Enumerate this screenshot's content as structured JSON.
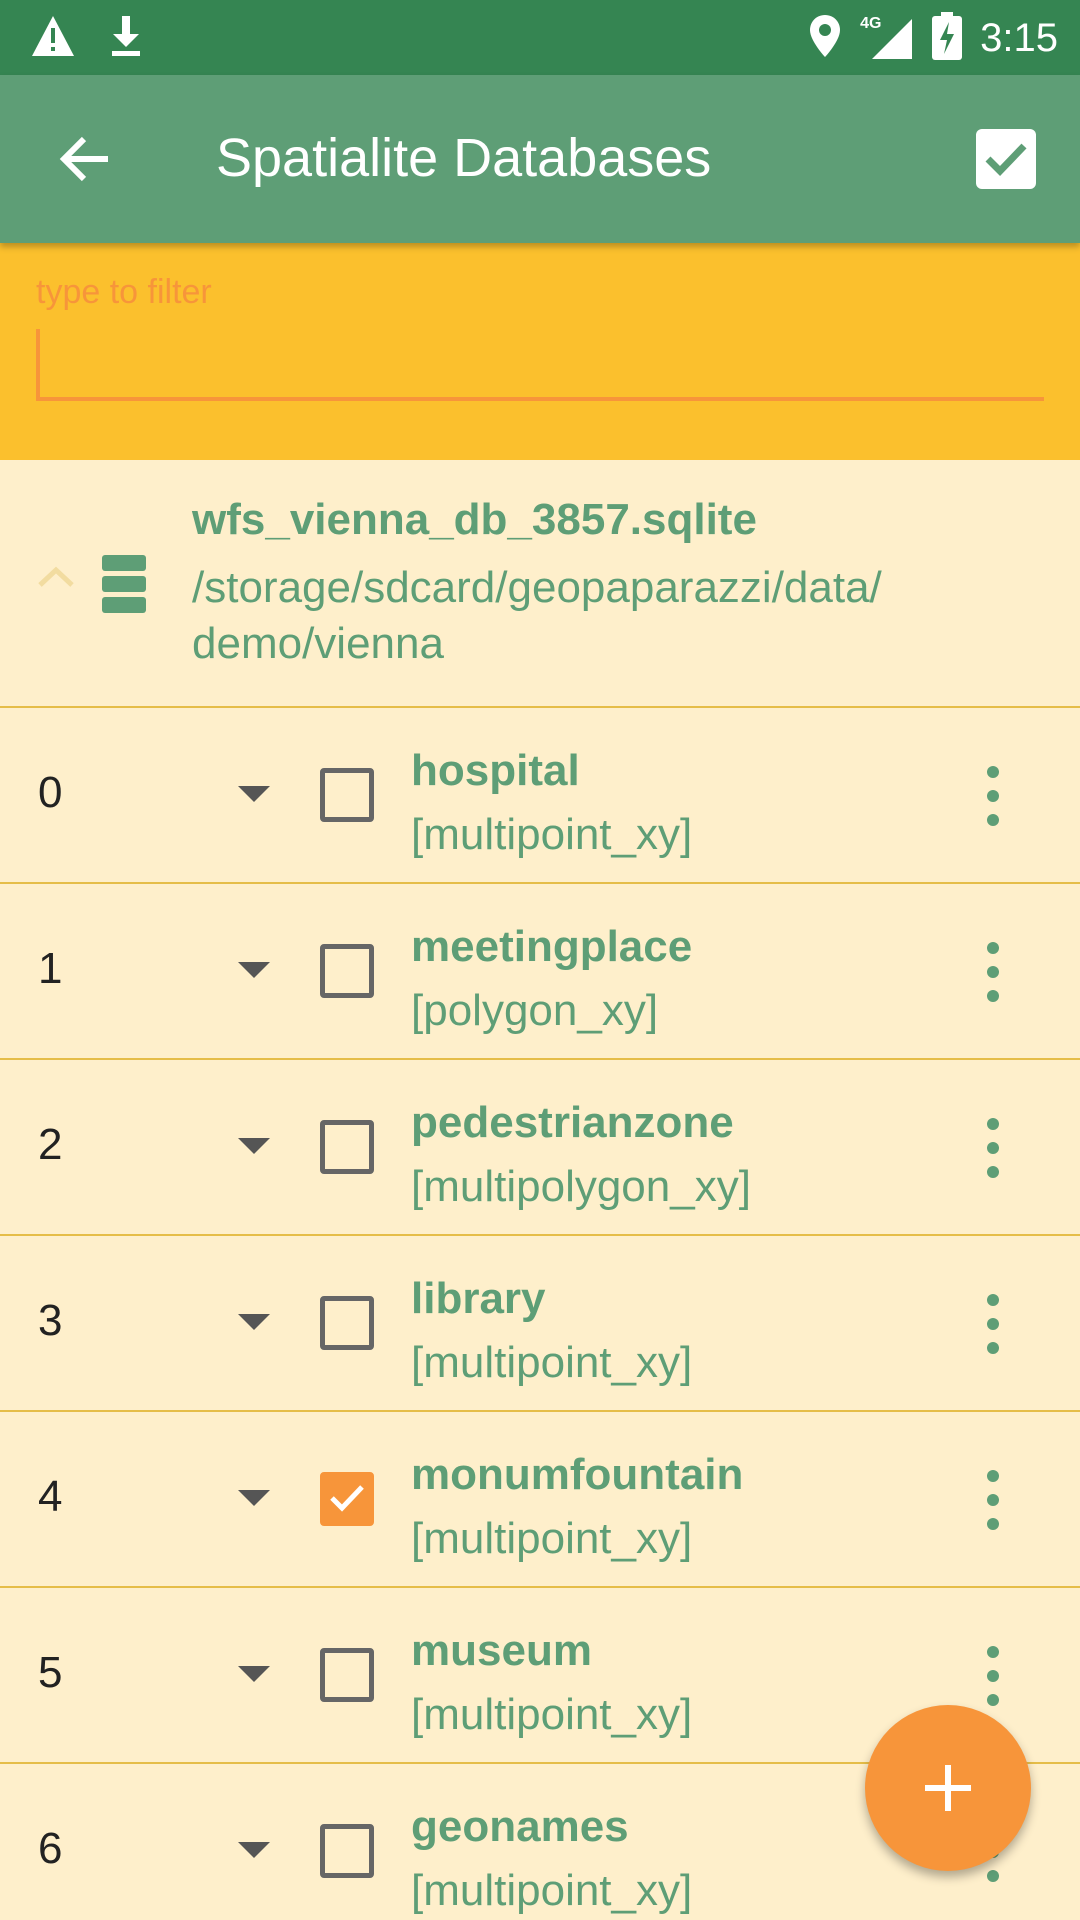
{
  "status_bar": {
    "time": "3:15",
    "network": "4G",
    "icons": [
      "warning-icon",
      "download-icon",
      "location-icon",
      "signal-icon",
      "battery-charging-icon"
    ]
  },
  "app_bar": {
    "title": "Spatialite Databases",
    "back_icon": "arrow-back-icon",
    "confirm_icon": "check-box-icon"
  },
  "filter": {
    "placeholder": "type to filter",
    "value": ""
  },
  "database": {
    "name": "wfs_vienna_db_3857.sqlite",
    "path": "/storage/sdcard/geopaparazzi/data/\ndemo/vienna",
    "expanded": true
  },
  "layers": [
    {
      "index": "0",
      "name": "hospital",
      "type": "[multipoint_xy]",
      "checked": false
    },
    {
      "index": "1",
      "name": "meetingplace",
      "type": "[polygon_xy]",
      "checked": false
    },
    {
      "index": "2",
      "name": "pedestrianzone",
      "type": "[multipolygon_xy]",
      "checked": false
    },
    {
      "index": "3",
      "name": "library",
      "type": "[multipoint_xy]",
      "checked": false
    },
    {
      "index": "4",
      "name": "monumfountain",
      "type": "[multipoint_xy]",
      "checked": true
    },
    {
      "index": "5",
      "name": "museum",
      "type": "[multipoint_xy]",
      "checked": false
    },
    {
      "index": "6",
      "name": "geonames",
      "type": "[multipoint_xy]",
      "checked": false
    }
  ],
  "fab": {
    "icon": "add-icon"
  },
  "colors": {
    "status_bar": "#358552",
    "app_bar": "#5E9E76",
    "filter_bg": "#FBC02D",
    "accent": "#F7953A",
    "list_bg": "#FEEFCB",
    "text_green": "#5E9E76"
  }
}
